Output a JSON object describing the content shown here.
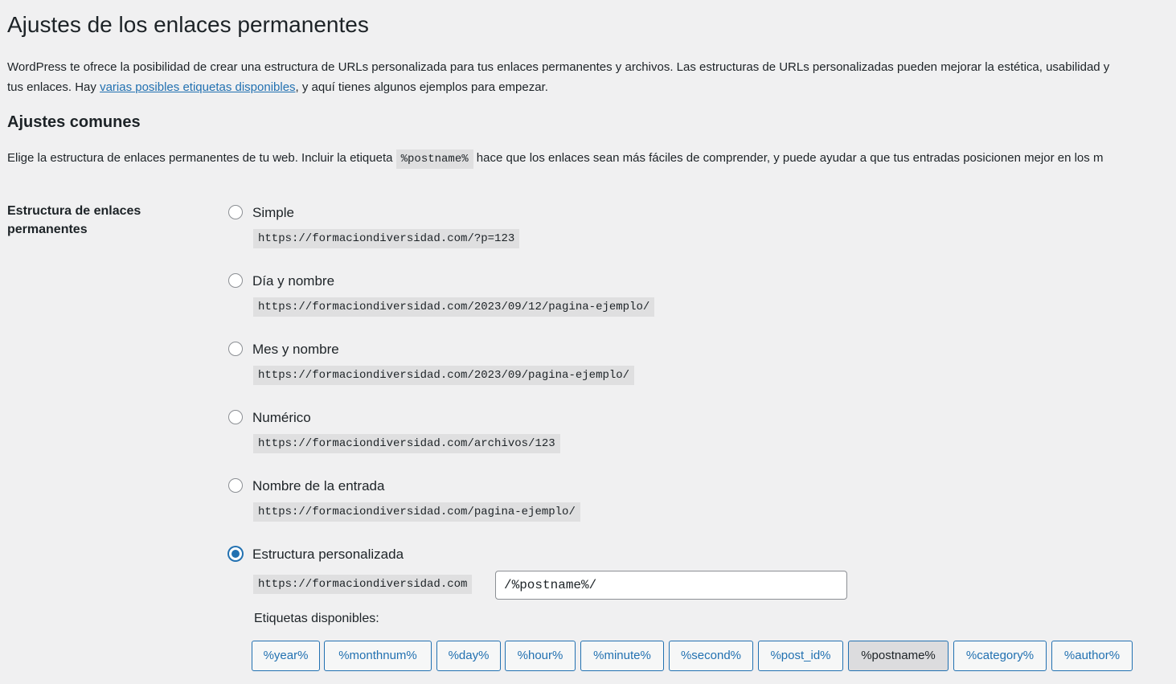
{
  "page": {
    "title": "Ajustes de los enlaces permanentes"
  },
  "intro": {
    "line1": "WordPress te ofrece la posibilidad de crear una estructura de URLs personalizada para tus enlaces permanentes y archivos. Las estructuras de URLs personalizadas pueden mejorar la estética, usabilidad y",
    "line2_before": "tus enlaces. Hay ",
    "link_text": "varias posibles etiquetas disponibles",
    "line2_after": ", y aquí tienes algunos ejemplos para empezar."
  },
  "common": {
    "title": "Ajustes comunes",
    "desc_before": "Elige la estructura de enlaces permanentes de tu web. Incluir la etiqueta ",
    "desc_code": "%postname%",
    "desc_after": " hace que los enlaces sean más fáciles de comprender, y puede ayudar a que tus entradas posicionen mejor en los m"
  },
  "structure": {
    "label": "Estructura de enlaces permanentes",
    "options": [
      {
        "label": "Simple",
        "example": "https://formaciondiversidad.com/?p=123",
        "checked": false
      },
      {
        "label": "Día y nombre",
        "example": "https://formaciondiversidad.com/2023/09/12/pagina-ejemplo/",
        "checked": false
      },
      {
        "label": "Mes y nombre",
        "example": "https://formaciondiversidad.com/2023/09/pagina-ejemplo/",
        "checked": false
      },
      {
        "label": "Numérico",
        "example": "https://formaciondiversidad.com/archivos/123",
        "checked": false
      },
      {
        "label": "Nombre de la entrada",
        "example": "https://formaciondiversidad.com/pagina-ejemplo/",
        "checked": false
      },
      {
        "label": "Estructura personalizada",
        "checked": true
      }
    ],
    "custom": {
      "base": "https://formaciondiversidad.com",
      "value": "/%postname%/"
    },
    "tags_label": "Etiquetas disponibles:",
    "tags": [
      "%year%",
      "%monthnum%",
      "%day%",
      "%hour%",
      "%minute%",
      "%second%",
      "%post_id%",
      "%postname%",
      "%category%",
      "%author%"
    ],
    "active_tag": "%postname%"
  },
  "colors": {
    "accent": "#2271b1",
    "background": "#f0f0f1",
    "text": "#1d2327"
  }
}
